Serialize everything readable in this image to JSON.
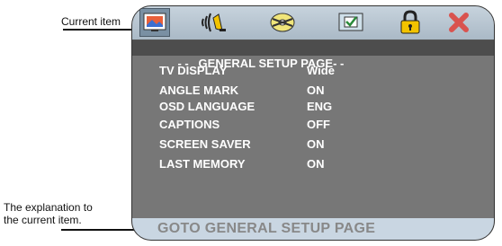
{
  "callouts": {
    "current_item": "Current item",
    "explanation_line1": "The explanation to",
    "explanation_line2": "the current item."
  },
  "icons": [
    {
      "name": "general-setup-icon",
      "selected": true
    },
    {
      "name": "audio-setup-icon",
      "selected": false
    },
    {
      "name": "video-setup-icon",
      "selected": false
    },
    {
      "name": "preference-icon",
      "selected": false
    },
    {
      "name": "lock-icon",
      "selected": false
    },
    {
      "name": "exit-icon",
      "selected": false
    }
  ],
  "menu": {
    "header": "- -   GENERAL SETUP PAGE- -",
    "rows": [
      {
        "label": "TV DISPLAY",
        "value": "Wide"
      },
      {
        "label": "ANGLE MARK",
        "value": "ON"
      },
      {
        "label": "OSD LANGUAGE",
        "value": "ENG"
      },
      {
        "label": "CAPTIONS",
        "value": "OFF"
      },
      {
        "label": "SCREEN SAVER",
        "value": "ON"
      },
      {
        "label": "LAST MEMORY",
        "value": "ON"
      }
    ]
  },
  "status_text": "GOTO GENERAL SETUP PAGE",
  "colors": {
    "panel": "#777777",
    "header": "#4d4d4d",
    "statusbar": "#c9d6e2",
    "exit_x": "#d9534f",
    "lock": "#f2c300"
  }
}
